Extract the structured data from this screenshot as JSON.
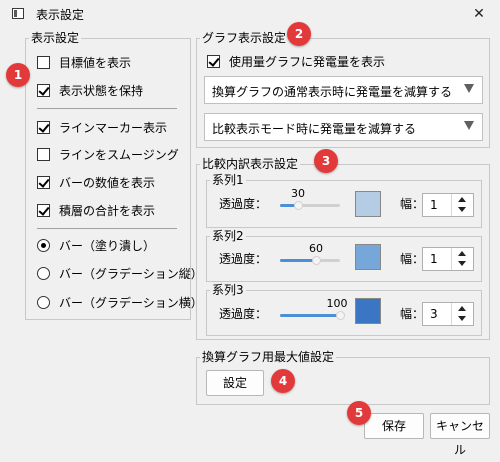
{
  "window": {
    "title": "表示設定",
    "close_glyph": "✕"
  },
  "display_group": {
    "title": "表示設定",
    "checks": [
      {
        "label": "目標値を表示",
        "checked": false
      },
      {
        "label": "表示状態を保持",
        "checked": true
      },
      {
        "label": "ラインマーカー表示",
        "checked": true
      },
      {
        "label": "ラインをスムージング",
        "checked": false
      },
      {
        "label": "バーの数値を表示",
        "checked": true
      },
      {
        "label": "積層の合計を表示",
        "checked": true
      }
    ],
    "radios": [
      {
        "label": "バー（塗り潰し）",
        "checked": true
      },
      {
        "label": "バー（グラデーション縦）",
        "checked": false
      },
      {
        "label": "バー（グラデーション横）",
        "checked": false
      }
    ]
  },
  "graph_group": {
    "title": "グラフ表示設定",
    "usage_check": {
      "label": "使用量グラフに発電量を表示",
      "checked": true
    },
    "combo1": "換算グラフの通常表示時に発電量を減算する",
    "combo2": "比較表示モード時に発電量を減算する"
  },
  "breakdown_group": {
    "title": "比較内訳表示設定",
    "opacity_label": "透過度：",
    "width_label": "幅：",
    "series": [
      {
        "name": "系列1",
        "opacity": 30,
        "width": 1,
        "color": "#b4cce4"
      },
      {
        "name": "系列2",
        "opacity": 60,
        "width": 1,
        "color": "#76a7d8"
      },
      {
        "name": "系列3",
        "opacity": 100,
        "width": 3,
        "color": "#3a76c4"
      }
    ]
  },
  "max_group": {
    "title": "換算グラフ用最大値設定",
    "button": "設定"
  },
  "footer": {
    "save": "保存",
    "cancel": "キャンセル"
  },
  "markers": [
    "1",
    "2",
    "3",
    "4",
    "5"
  ],
  "colors": {
    "accent": "#4a8fd8",
    "marker": "#e23a3a"
  }
}
